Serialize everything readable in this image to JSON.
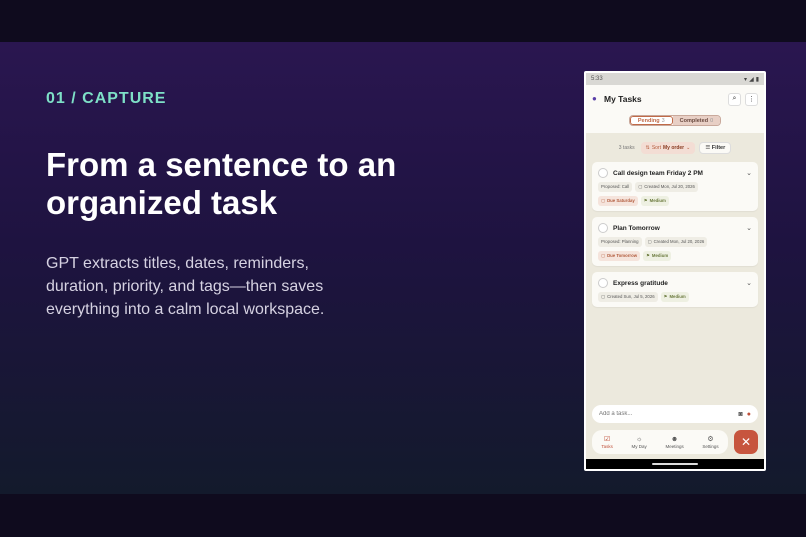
{
  "slide": {
    "kicker": "01 / CAPTURE",
    "headline": "From a sentence to an organized task",
    "subcopy": "GPT extracts titles, dates, reminders, duration, priority, and tags—then saves everything into a calm local workspace."
  },
  "phone": {
    "status_time": "5:33",
    "status_icons": [
      "wifi-icon",
      "signal-icon",
      "battery-icon"
    ],
    "app_title": "My Tasks",
    "tabs": [
      {
        "label": "Pending",
        "count": "3",
        "selected": true
      },
      {
        "label": "Completed",
        "count": "0",
        "selected": false
      }
    ],
    "toolbar": {
      "task_count": "3 tasks",
      "sort_prefix": "Sort",
      "sort_value": "My order",
      "filter_label": "Filter"
    },
    "tasks": [
      {
        "title": "Call design team Friday 2 PM",
        "proposed": "Proposed: Call",
        "created": "Created Mon, Jul 20, 2026",
        "due": "Due Saturday",
        "priority": "Medium"
      },
      {
        "title": "Plan Tomorrow",
        "proposed": "Proposed: Planning",
        "created": "Created Mon, Jul 20, 2026",
        "due": "Due Tomorrow",
        "priority": "Medium"
      },
      {
        "title": "Express gratitude",
        "created": "Created Sun, Jul 5, 2026",
        "priority": "Medium"
      }
    ],
    "input": {
      "placeholder": "Add a task..."
    },
    "nav": [
      {
        "label": "Tasks",
        "icon": "tasks-icon",
        "active": true
      },
      {
        "label": "My Day",
        "icon": "sun-icon",
        "active": false
      },
      {
        "label": "Meetings",
        "icon": "people-icon",
        "active": false
      },
      {
        "label": "Settings",
        "icon": "gear-icon",
        "active": false
      }
    ],
    "colors": {
      "accent": "#c7553e",
      "kicker": "#7ee0c7"
    }
  }
}
